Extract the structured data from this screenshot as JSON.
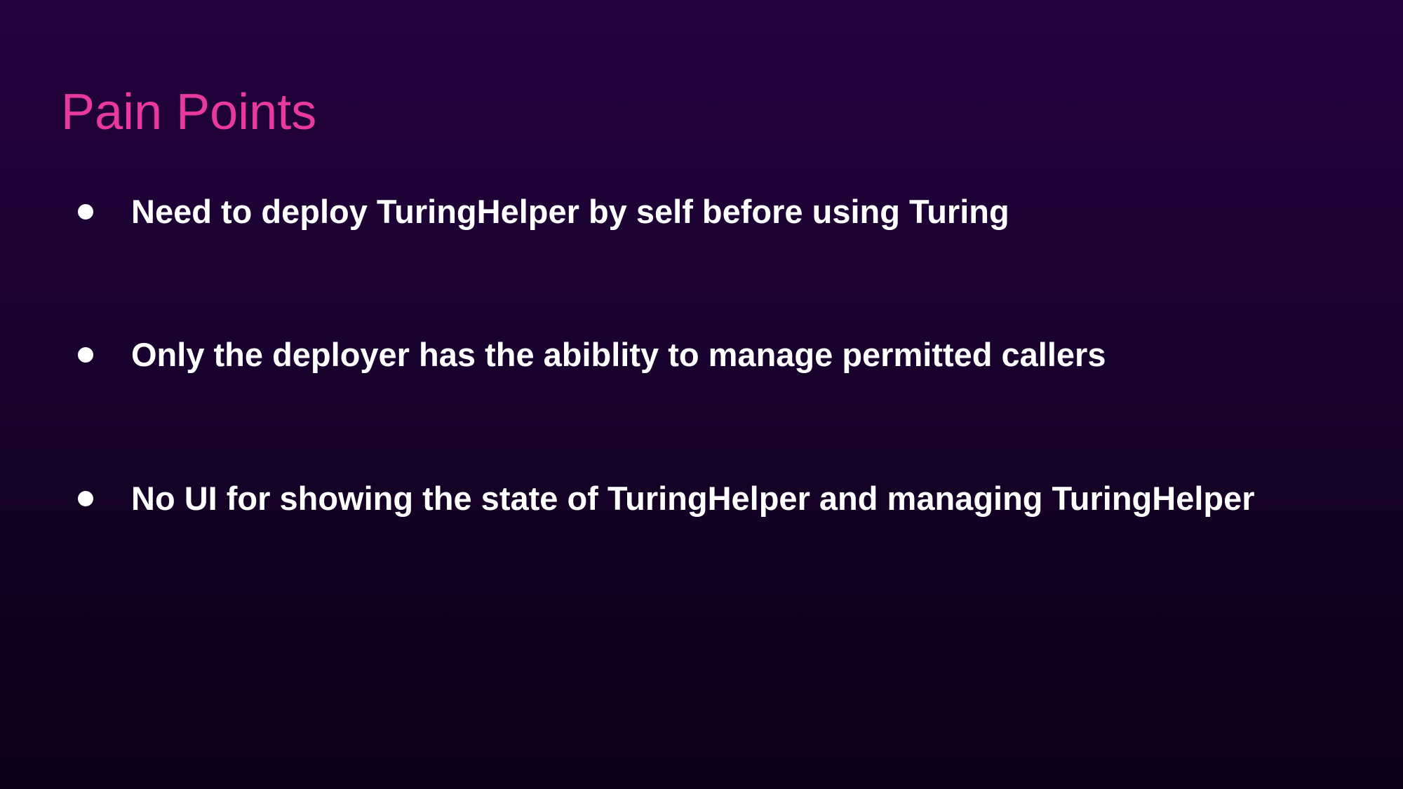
{
  "slide": {
    "title": "Pain Points",
    "bullets": [
      {
        "text": "Need to deploy TuringHelper by self before using Turing"
      },
      {
        "text": "Only the deployer has the abiblity to manage permitted callers"
      },
      {
        "text": "No UI for showing the state of TuringHelper and managing TuringHelper"
      }
    ]
  },
  "colors": {
    "title": "#e8399e",
    "text": "#ffffff",
    "background_top": "#24023e",
    "background_bottom": "#0c0015"
  }
}
